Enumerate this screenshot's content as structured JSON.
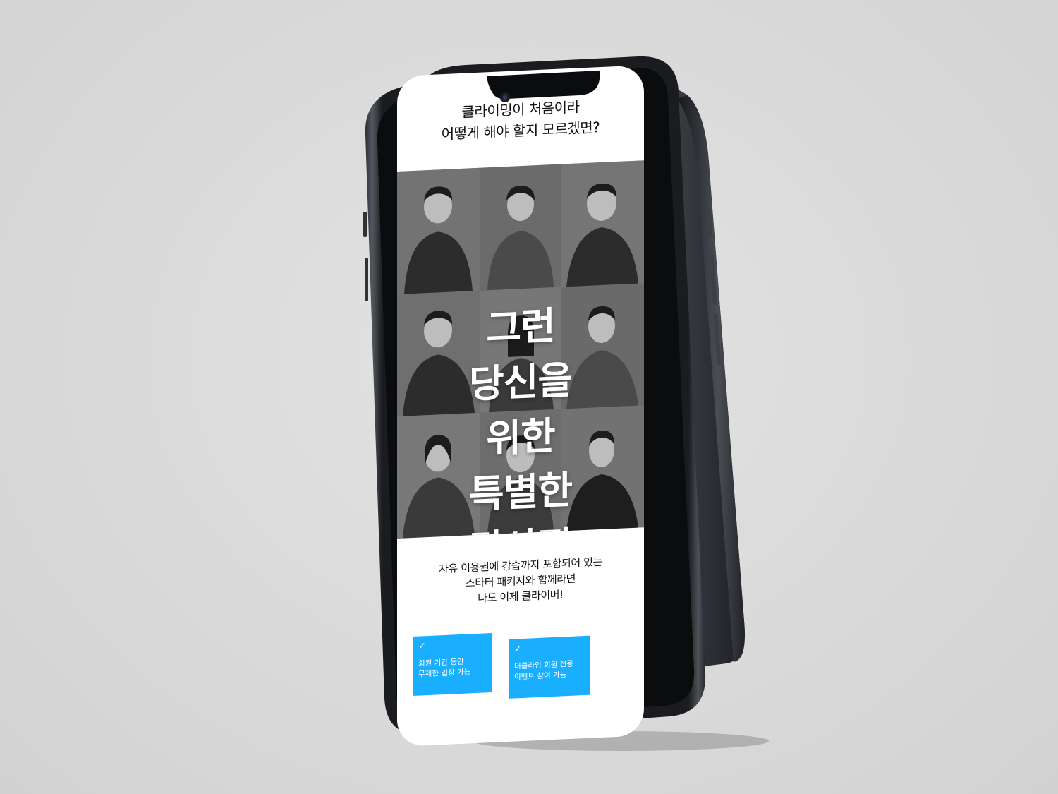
{
  "screen": {
    "intro_line1": "클라이밍이 처음이라",
    "intro_line2": "어떻게 해야 할지 모르겠면?",
    "headline": [
      "그런",
      "당신을",
      "위한",
      "특별한",
      "강사진"
    ],
    "description": [
      "자유 이용권에 강습까지 포함되어 있는",
      "스타터 패키지와 함께라면",
      "나도 이제 클라이머!"
    ],
    "features": [
      {
        "icon": "check-icon",
        "line1": "회원 기간 동안",
        "line2": "무제한 입장 가능"
      },
      {
        "icon": "check-icon",
        "line1": "더클라임 회원 전용",
        "line2": "이벤트 참여 가능"
      }
    ]
  },
  "colors": {
    "accent": "#1aaeff",
    "background": "#dcdcdc",
    "phone_body": "#1f2226",
    "photo_bg": "#6e6e6e"
  }
}
